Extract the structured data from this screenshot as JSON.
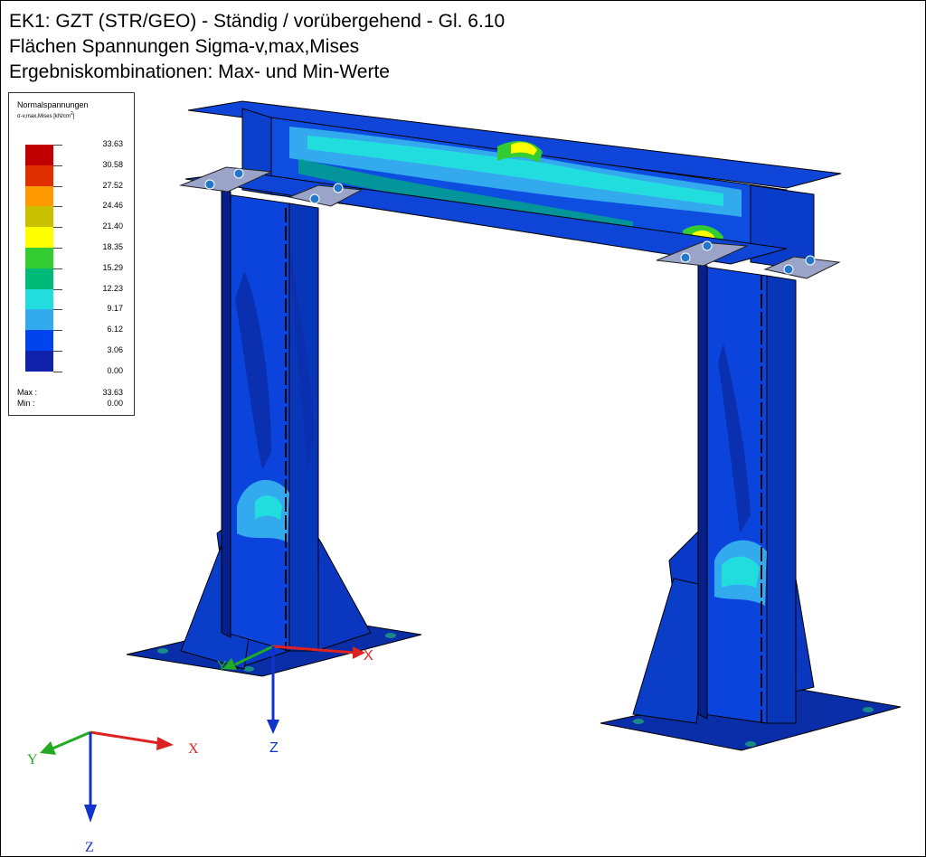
{
  "header": {
    "line1": "EK1: GZT (STR/GEO) - Ständig / vorübergehend - Gl. 6.10",
    "line2": "Flächen Spannungen Sigma-v,max,Mises",
    "line3": "Ergebniskombinationen: Max- und Min-Werte"
  },
  "legend": {
    "title": "Normalspannungen",
    "symbol": "σ",
    "subscript": "-v,max,Mises [kN/cm",
    "exponent": "2",
    "close": "]",
    "values": [
      "33.63",
      "30.58",
      "27.52",
      "24.46",
      "21.40",
      "18.35",
      "15.29",
      "12.23",
      "9.17",
      "6.12",
      "3.06",
      "0.00"
    ],
    "colors": [
      "#c00000",
      "#e03000",
      "#ff9900",
      "#c8c000",
      "#ffff00",
      "#33cc33",
      "#00bb77",
      "#22dddd",
      "#33aaee",
      "#0044ee",
      "#1122aa"
    ],
    "max_label": "Max :",
    "max_value": "33.63",
    "min_label": "Min :",
    "min_value": "0.00"
  },
  "axes": {
    "x": "X",
    "y": "Y",
    "z": "Z",
    "x_color": "#dd2222",
    "y_color": "#22aa22",
    "z_color": "#1133cc"
  },
  "colors": {
    "deep_blue": "#1122aa",
    "blue": "#0044ee",
    "light_blue": "#33aaee",
    "cyan": "#22dddd",
    "green": "#00bb77"
  }
}
